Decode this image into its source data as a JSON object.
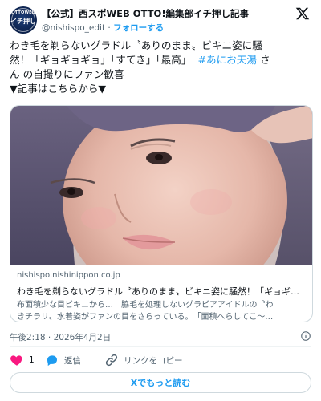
{
  "account": {
    "avatar_text_top": "OTTOWEB",
    "avatar_text_main": "イチ押し",
    "name": "【公式】西スポWEB OTTO!編集部イチ押し記事",
    "handle": "@nishispo_edit",
    "separator": " · ",
    "follow_label": "フォローする"
  },
  "tweet": {
    "line1": "わき毛を剃らないグラドル〝ありのまま〟ビキニ姿に騒",
    "line2": "然！「ギョギョギョ」「すてき」「最高」",
    "hashtag": "#あにお天湯",
    "line2_tail": " さ",
    "line3": "ん の自撮りにファン歓喜",
    "line4": "▼記事はこちらから▼"
  },
  "card": {
    "domain": "nishispo.nishinippon.co.jp",
    "title": "わき毛を剃らないグラドル〝ありのまま〟ビキニ姿に騒然！「ギョギ…",
    "desc_line1": "布面積少な目ビキニから…　脇毛を処理しないグラビアアイドルの〝わ",
    "desc_line2": "きチラリ〟水着姿がファンの目をさらっている。　「面積へらしてこ〜…"
  },
  "meta": {
    "timestamp": "午後2:18 · 2026年4月2日"
  },
  "actions": {
    "like_count": "1",
    "reply_label": "返信",
    "copy_label": "リンクをコピー"
  },
  "read_more_label": "Xでもっと読む",
  "colors": {
    "accent": "#1d9bf0",
    "like": "#f91880",
    "text": "#0f1419",
    "muted": "#536471",
    "border": "#cfd9de"
  },
  "icons": {
    "brand": "x-logo-icon",
    "info": "info-icon",
    "like": "heart-icon",
    "reply": "reply-bubble-icon",
    "copy": "link-icon"
  }
}
